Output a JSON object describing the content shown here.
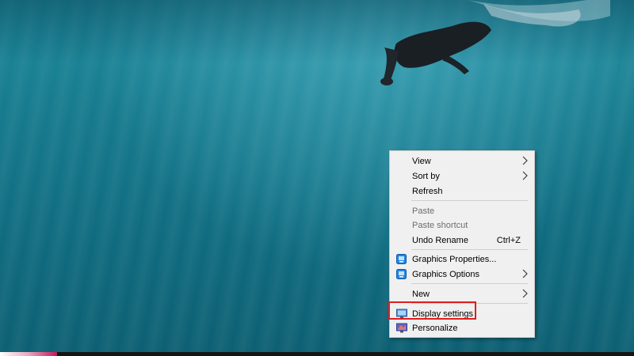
{
  "desktop": {
    "wallpaper": "underwater-swimmer",
    "taskbar_accent_color": "#c2185b"
  },
  "context_menu": {
    "items": [
      {
        "label": "View",
        "has_submenu": true
      },
      {
        "label": "Sort by",
        "has_submenu": true
      },
      {
        "label": "Refresh"
      },
      {
        "label": "Paste",
        "disabled": true
      },
      {
        "label": "Paste shortcut",
        "disabled": true
      },
      {
        "label": "Undo Rename",
        "shortcut": "Ctrl+Z"
      },
      {
        "label": "Graphics Properties...",
        "icon": "intel-graphics-icon"
      },
      {
        "label": "Graphics Options",
        "icon": "intel-graphics-icon",
        "has_submenu": true
      },
      {
        "label": "New",
        "has_submenu": true
      },
      {
        "label": "Display settings",
        "icon": "display-icon",
        "highlighted": true
      },
      {
        "label": "Personalize",
        "icon": "personalize-icon"
      }
    ],
    "highlight_color": "#e01e1e"
  }
}
